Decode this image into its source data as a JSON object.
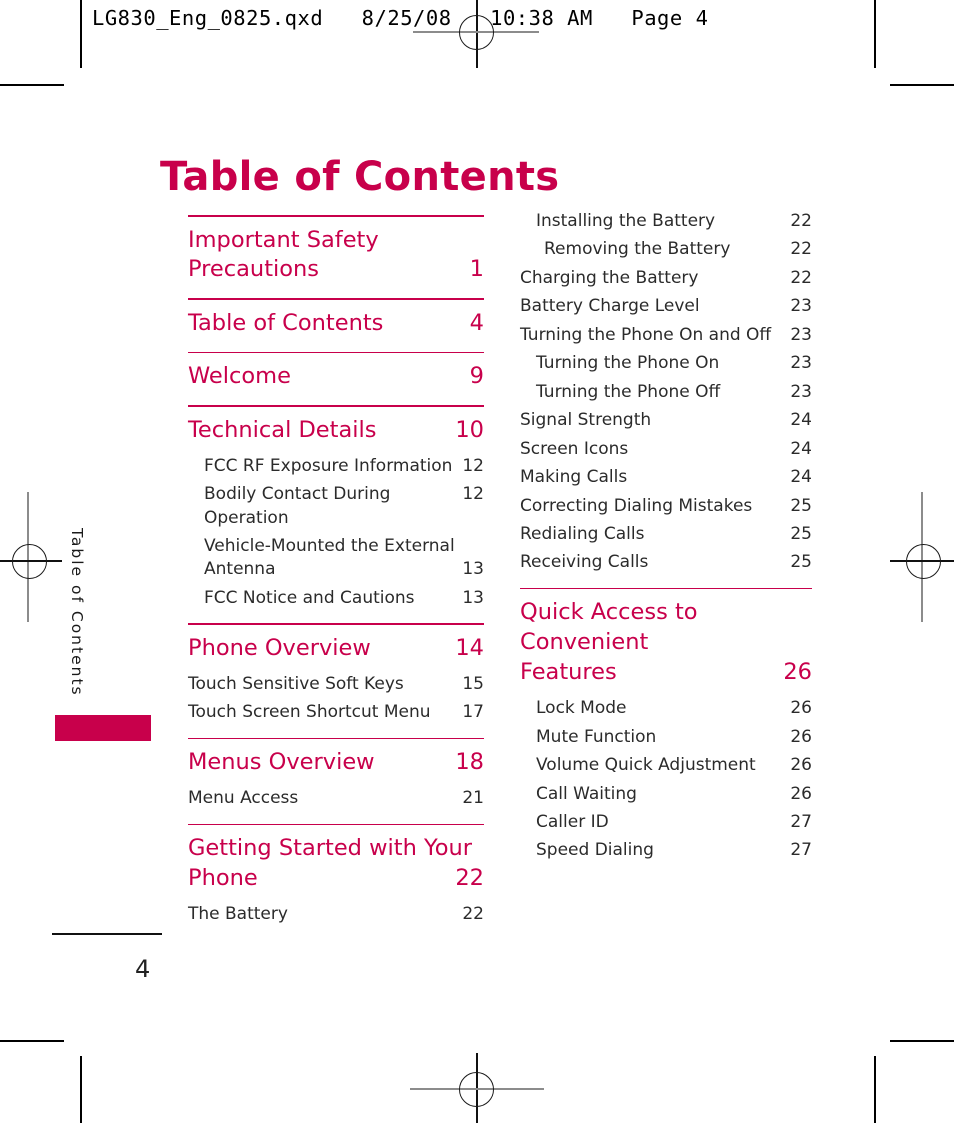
{
  "proof_header": {
    "text": "LG830_Eng_0825.qxd   8/25/08   10:38 AM   Page 4"
  },
  "page": {
    "title": "Table of Contents",
    "side_tab_label": "Table of Contents",
    "folio": "4",
    "accent_color": "#C8004B",
    "text_color": "#2b2b2b"
  },
  "toc": {
    "left_column": [
      {
        "type": "rule"
      },
      {
        "type": "major",
        "label": "Important Safety Precautions",
        "label_line1": "Important Safety",
        "label_line2": "Precautions",
        "page": "1",
        "indent": 0
      },
      {
        "type": "rule"
      },
      {
        "type": "major",
        "label": "Table of Contents",
        "page": "4",
        "indent": 0
      },
      {
        "type": "rule"
      },
      {
        "type": "major",
        "label": "Welcome",
        "page": "9",
        "indent": 0
      },
      {
        "type": "rule"
      },
      {
        "type": "major",
        "label": "Technical Details",
        "page": "10",
        "indent": 0
      },
      {
        "type": "sub",
        "label": "FCC RF Exposure Information",
        "page": "12",
        "indent": 1
      },
      {
        "type": "sub",
        "label": "Bodily Contact During Operation",
        "page": "12",
        "indent": 1
      },
      {
        "type": "sub",
        "label": "Vehicle-Mounted the External Antenna",
        "label_line1": "Vehicle-Mounted the External",
        "label_line2": "Antenna",
        "page": "13",
        "indent": 1
      },
      {
        "type": "sub",
        "label": "FCC Notice and Cautions",
        "page": "13",
        "indent": 1
      },
      {
        "type": "rule"
      },
      {
        "type": "major",
        "label": "Phone Overview",
        "page": "14",
        "indent": 0
      },
      {
        "type": "sub",
        "label": "Touch Sensitive Soft Keys",
        "page": "15",
        "indent": 0
      },
      {
        "type": "sub",
        "label": "Touch Screen Shortcut Menu",
        "page": "17",
        "indent": 0
      },
      {
        "type": "rule"
      },
      {
        "type": "major",
        "label": "Menus Overview",
        "page": "18",
        "indent": 0
      },
      {
        "type": "sub",
        "label": "Menu Access",
        "page": "21",
        "indent": 0
      },
      {
        "type": "rule"
      },
      {
        "type": "major",
        "label": "Getting Started with Your Phone",
        "label_line1": "Getting Started with Your",
        "label_line2": "Phone",
        "page": "22",
        "indent": 0
      },
      {
        "type": "sub",
        "label": "The Battery",
        "page": "22",
        "indent": 0
      }
    ],
    "right_column": [
      {
        "type": "sub",
        "label": "Installing the Battery",
        "page": "22",
        "indent": 1
      },
      {
        "type": "sub",
        "label": "Removing the Battery",
        "page": "22",
        "indent": 2
      },
      {
        "type": "sub",
        "label": "Charging the Battery",
        "page": "22",
        "indent": 0
      },
      {
        "type": "sub",
        "label": "Battery Charge Level",
        "page": "23",
        "indent": 0
      },
      {
        "type": "sub",
        "label": "Turning the Phone On and Off",
        "page": "23",
        "indent": 0
      },
      {
        "type": "sub",
        "label": "Turning the Phone On",
        "page": "23",
        "indent": 1
      },
      {
        "type": "sub",
        "label": "Turning the Phone Off",
        "page": "23",
        "indent": 1
      },
      {
        "type": "sub",
        "label": "Signal Strength",
        "page": "24",
        "indent": 0
      },
      {
        "type": "sub",
        "label": "Screen Icons",
        "page": "24",
        "indent": 0
      },
      {
        "type": "sub",
        "label": "Making Calls",
        "page": "24",
        "indent": 0
      },
      {
        "type": "sub",
        "label": "Correcting Dialing Mistakes",
        "page": "25",
        "indent": 0
      },
      {
        "type": "sub",
        "label": "Redialing Calls",
        "page": "25",
        "indent": 0
      },
      {
        "type": "sub",
        "label": "Receiving Calls",
        "page": "25",
        "indent": 0
      },
      {
        "type": "rule"
      },
      {
        "type": "major",
        "label": "Quick Access to Convenient Features",
        "label_line1": "Quick Access to Convenient",
        "label_line2": "Features",
        "page": "26",
        "indent": 0
      },
      {
        "type": "sub",
        "label": "Lock Mode",
        "page": "26",
        "indent": 1
      },
      {
        "type": "sub",
        "label": "Mute Function",
        "page": "26",
        "indent": 1
      },
      {
        "type": "sub",
        "label": "Volume Quick Adjustment",
        "page": "26",
        "indent": 1
      },
      {
        "type": "sub",
        "label": "Call Waiting",
        "page": "26",
        "indent": 1
      },
      {
        "type": "sub",
        "label": "Caller ID",
        "page": "27",
        "indent": 1
      },
      {
        "type": "sub",
        "label": "Speed Dialing",
        "page": "27",
        "indent": 1
      }
    ]
  }
}
